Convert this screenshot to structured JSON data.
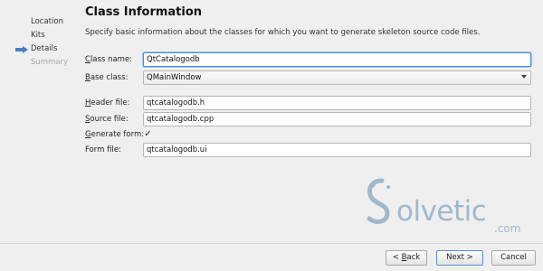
{
  "sidebar": {
    "steps": [
      {
        "label": "Location",
        "state": "done"
      },
      {
        "label": "Kits",
        "state": "done"
      },
      {
        "label": "Details",
        "state": "current"
      },
      {
        "label": "Summary",
        "state": "disabled"
      }
    ],
    "current_icon": "arrow-right-icon"
  },
  "header": {
    "title": "Class Information",
    "description": "Specify basic information about the classes for which you want to generate skeleton source code files."
  },
  "form": {
    "class_name": {
      "label_mnemonic": "C",
      "label_rest": "lass name:",
      "value": "QtCatalogodb"
    },
    "base_class": {
      "label_mnemonic": "B",
      "label_rest": "ase class:",
      "value": "QMainWindow"
    },
    "header_file": {
      "label_mnemonic": "H",
      "label_rest": "eader file:",
      "value": "qtcatalogodb.h"
    },
    "source_file": {
      "label_mnemonic": "S",
      "label_rest": "ource file:",
      "value": "qtcatalogodb.cpp"
    },
    "generate_form": {
      "label_mnemonic": "G",
      "label_rest": "enerate form:",
      "checked": true,
      "check_glyph": "✓"
    },
    "form_file": {
      "label": "Form file:",
      "value": "qtcatalogodb.ui"
    }
  },
  "buttons": {
    "back_prefix": "< ",
    "back_mnemonic": "B",
    "back_rest": "ack",
    "next_label": "Next >",
    "cancel_label": "Cancel"
  },
  "watermark": {
    "text": "olvetic",
    "suffix": ".com",
    "color": "#9fb8cc"
  },
  "colors": {
    "focus": "#4a90d9",
    "arrow": "#4a7fc0"
  }
}
